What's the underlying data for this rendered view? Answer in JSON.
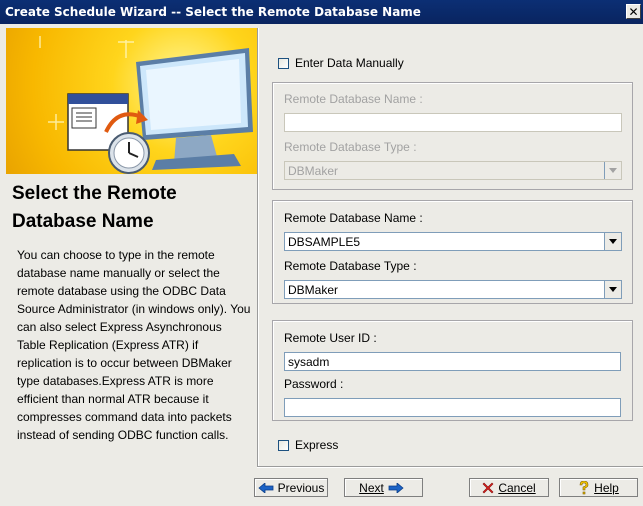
{
  "window": {
    "title": "Create Schedule Wizard -- Select the Remote Database Name",
    "close_glyph": "✕"
  },
  "left": {
    "heading": "Select the Remote Database Name",
    "description": "You can choose to type in the remote database name manually or select the remote database using the ODBC Data Source Administrator (in windows only). You can also select Express Asynchronous Table Replication (Express ATR) if replication is to occur between DBMaker type databases.Express ATR is more efficient than normal ATR because it compresses command data into packets instead of sending ODBC function calls."
  },
  "manual": {
    "checkbox_label": "Enter Data Manually",
    "checked": false,
    "name_label": "Remote Database Name :",
    "name_value": "",
    "type_label": "Remote Database Type :",
    "type_value": "DBMaker"
  },
  "select": {
    "name_label": "Remote Database Name :",
    "name_value": "DBSAMPLE5",
    "type_label": "Remote Database Type :",
    "type_value": "DBMaker"
  },
  "credentials": {
    "user_label": "Remote User ID :",
    "user_value": "sysadm",
    "password_label": "Password :",
    "password_value": ""
  },
  "express": {
    "label": "Express",
    "checked": false
  },
  "buttons": {
    "previous": "Previous",
    "next": "Next",
    "cancel": "Cancel",
    "help": "Help"
  },
  "icons": {
    "previous": "left-arrow-icon",
    "next": "right-arrow-icon",
    "cancel": "red-x-icon",
    "help": "question-mark-icon"
  },
  "colors": {
    "title_bar": "#0a2460",
    "banner": "#f8b800",
    "field_border": "#7f9db9"
  }
}
